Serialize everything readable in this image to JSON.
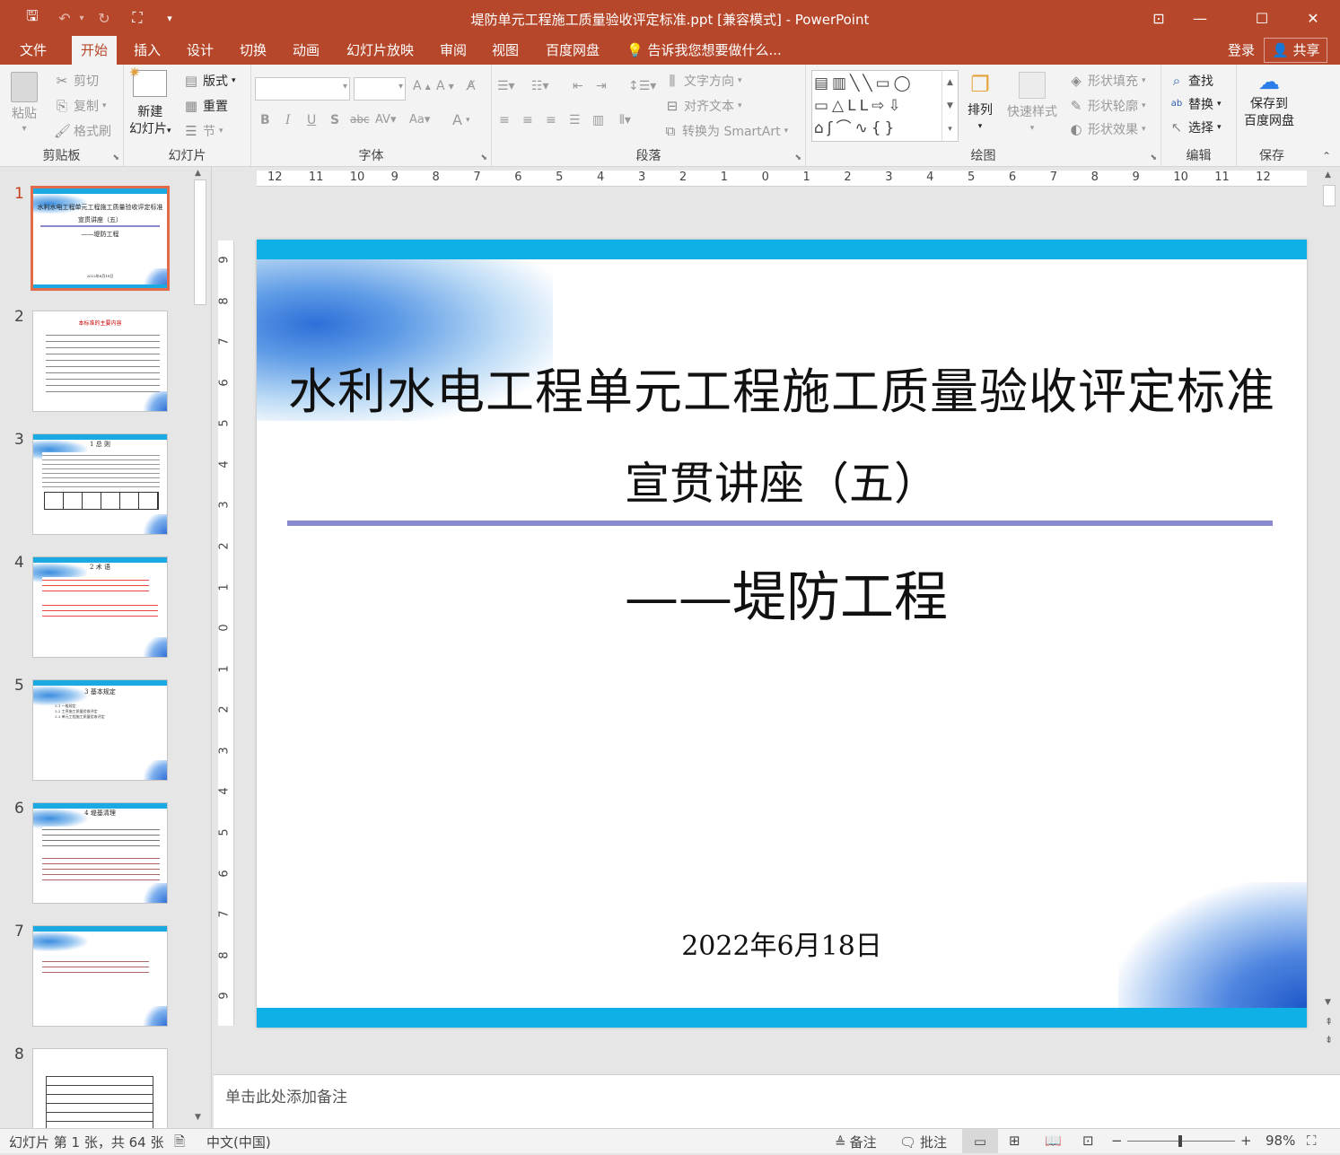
{
  "window": {
    "title": "堤防单元工程施工质量验收评定标准.ppt [兼容模式] - PowerPoint",
    "controls": {
      "ribbon_display": "⊡",
      "minimize": "—",
      "maximize": "☐",
      "close": "✕"
    }
  },
  "quick_access": {
    "save": "🖫",
    "undo": "↶",
    "redo": "↻",
    "present": "⛶",
    "more": "▾"
  },
  "tabs": [
    "文件",
    "开始",
    "插入",
    "设计",
    "切换",
    "动画",
    "幻灯片放映",
    "审阅",
    "视图",
    "百度网盘"
  ],
  "active_tab": "开始",
  "tell_me": "告诉我您想要做什么...",
  "account": {
    "login": "登录",
    "share": "共享"
  },
  "ribbon": {
    "clipboard": {
      "label": "剪贴板",
      "paste": "粘贴",
      "cut": "剪切",
      "copy": "复制",
      "format_painter": "格式刷"
    },
    "slides": {
      "label": "幻灯片",
      "new_slide_line1": "新建",
      "new_slide_line2": "幻灯片",
      "layout": "版式",
      "reset": "重置",
      "section": "节"
    },
    "font": {
      "label": "字体",
      "font_name": "",
      "font_size": ""
    },
    "paragraph": {
      "label": "段落",
      "text_direction": "文字方向",
      "align_text": "对齐文本",
      "smartart": "转换为 SmartArt"
    },
    "drawing": {
      "label": "绘图",
      "arrange": "排列",
      "quick_styles": "快速样式",
      "shape_fill": "形状填充",
      "shape_outline": "形状轮廓",
      "shape_effects": "形状效果"
    },
    "editing": {
      "label": "编辑",
      "find": "查找",
      "replace": "替换",
      "select": "选择"
    },
    "save": {
      "label": "保存",
      "save_to_line1": "保存到",
      "save_to_line2": "百度网盘"
    }
  },
  "thumbnails": [
    {
      "num": "1",
      "title": "水利水电工程单元工程施工质量验收评定标准",
      "subtitle": "宣贯讲座（五）",
      "sub2": "——堤防工程",
      "date": "2022年6月18日"
    },
    {
      "num": "2",
      "title": "本标准的主要内容"
    },
    {
      "num": "3",
      "title": "1 总 则"
    },
    {
      "num": "4",
      "title": "2 术 语"
    },
    {
      "num": "5",
      "title": "3 基本规定",
      "lines": [
        "3.1 一般规定",
        "3.2 工序施工质量验收评定",
        "3.3 单元工程施工质量验收评定"
      ]
    },
    {
      "num": "6",
      "title": "4 堤基清理"
    },
    {
      "num": "7",
      "title": ""
    },
    {
      "num": "8",
      "title": ""
    }
  ],
  "ruler": {
    "h_labels": [
      "12",
      "11",
      "10",
      "9",
      "8",
      "7",
      "6",
      "5",
      "4",
      "3",
      "2",
      "1",
      "0",
      "1",
      "2",
      "3",
      "4",
      "5",
      "6",
      "7",
      "8",
      "9",
      "10",
      "11",
      "12"
    ],
    "v_labels": [
      "9",
      "8",
      "7",
      "6",
      "5",
      "4",
      "3",
      "2",
      "1",
      "0",
      "1",
      "2",
      "3",
      "4",
      "5",
      "6",
      "7",
      "8",
      "9"
    ]
  },
  "slide": {
    "title_line1": "水利水电工程单元工程施工质量验收评定标准",
    "title_line2": "宣贯讲座（五）",
    "subtitle": "——堤防工程",
    "date": "2022年6月18日"
  },
  "notes": {
    "placeholder": "单击此处添加备注"
  },
  "status": {
    "slide_info": "幻灯片 第 1 张，共 64 张",
    "language": "中文(中国)",
    "notes_btn": "备注",
    "comments_btn": "批注",
    "zoom": "98%",
    "zoom_level": 0.49
  },
  "colors": {
    "accent": "#b7472a",
    "slide_band": "#0fb0e6",
    "divider": "#8a89d0"
  }
}
